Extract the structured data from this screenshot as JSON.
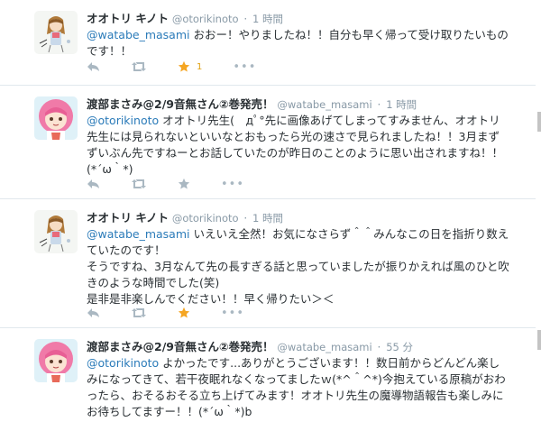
{
  "colors": {
    "mention": "#2b7bb9",
    "meta": "#8899a6",
    "favorited_star": "#f5a623",
    "action_icon": "#aab8c2"
  },
  "tweets": [
    {
      "name": "オオトリ キノト",
      "handle": "@otorikinoto",
      "time": "1 時間",
      "mention": "@watabe_masami",
      "text": "おおー！やりましたね！！自分も早く帰って受け取りたいものです！！",
      "favorited": true,
      "fav_count": "1",
      "avatar": "girl-illustration-avatar"
    },
    {
      "name": "渡部まさみ@2/9音無さん②巻発売！",
      "handle": "@watabe_masami",
      "time": "1 時間",
      "mention": "@otorikinoto",
      "text": "オオトリ先生(　дﾟ°先に画像あげてしまってすみません、オオトリ先生には見られないといいなとおもったら光の速さで見られましたね！！3月まずずいぶん先ですねーとお話していたのが昨日のことのように思い出されますね！！(*´ω｀*)",
      "favorited": false,
      "fav_count": "",
      "avatar": "pink-hair-girl-avatar"
    },
    {
      "name": "オオトリ キノト",
      "handle": "@otorikinoto",
      "time": "1 時間",
      "mention": "@watabe_masami",
      "text": "いえいえ全然！お気になさらず＾＾みんなこの日を指折り数えていたのです！",
      "text2": "そうですね、3月なんて先の長すぎる話と思っていましたが振りかえれば風のひと吹きのような時間でした(笑)",
      "text3": "是非是非楽しんでください！！早く帰りたい＞＜",
      "favorited": true,
      "fav_count": "",
      "avatar": "girl-illustration-avatar"
    },
    {
      "name": "渡部まさみ@2/9音無さん②巻発売！",
      "handle": "@watabe_masami",
      "time": "55 分",
      "mention": "@otorikinoto",
      "text": "よかったです...ありがとうございます！！数日前からどんどん楽しみになってきて、若干夜眠れなくなってましたｗ(*^＾^*)今抱えている原稿がおわったら、おそるおそる立ち上げてみます！オオトリ先生の魔導物語報告も楽しみにお待ちしてますー！！(*´ω｀*)b",
      "avatar": "pink-hair-girl-avatar"
    }
  ],
  "more_glyph": "•••"
}
